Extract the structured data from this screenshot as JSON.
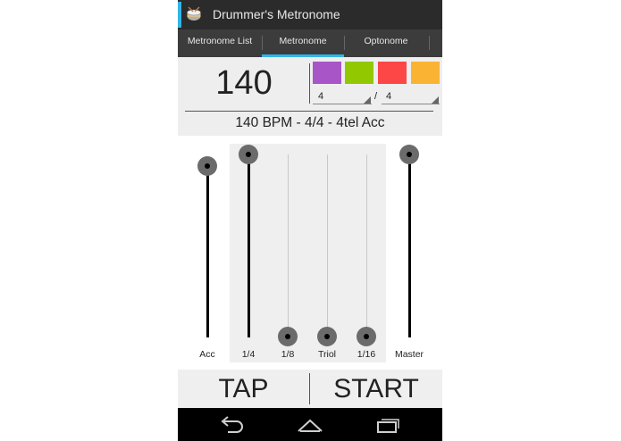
{
  "app": {
    "title": "Drummer's Metronome"
  },
  "tabs": [
    {
      "label": "Metronome List"
    },
    {
      "label": "Metronome"
    },
    {
      "label": "Optonome"
    }
  ],
  "metronome": {
    "bpm": "140",
    "colors": [
      "#a855c8",
      "#92c800",
      "#fd4646",
      "#fbb334"
    ],
    "beats": "4",
    "slash": "/",
    "note_value": "4",
    "summary": "140 BPM - 4/4 - 4tel Acc"
  },
  "sliders": [
    {
      "label": "Acc",
      "level": 0.87
    },
    {
      "label": "1/4",
      "level": 1.0
    },
    {
      "label": "1/8",
      "level": 0.0
    },
    {
      "label": "Triol",
      "level": 0.0
    },
    {
      "label": "1/16",
      "level": 0.0
    },
    {
      "label": "Master",
      "level": 1.0
    }
  ],
  "buttons": {
    "tap": "TAP",
    "start": "START"
  },
  "navbar": {
    "icons": [
      "back-icon",
      "home-icon",
      "recent-apps-icon"
    ]
  }
}
